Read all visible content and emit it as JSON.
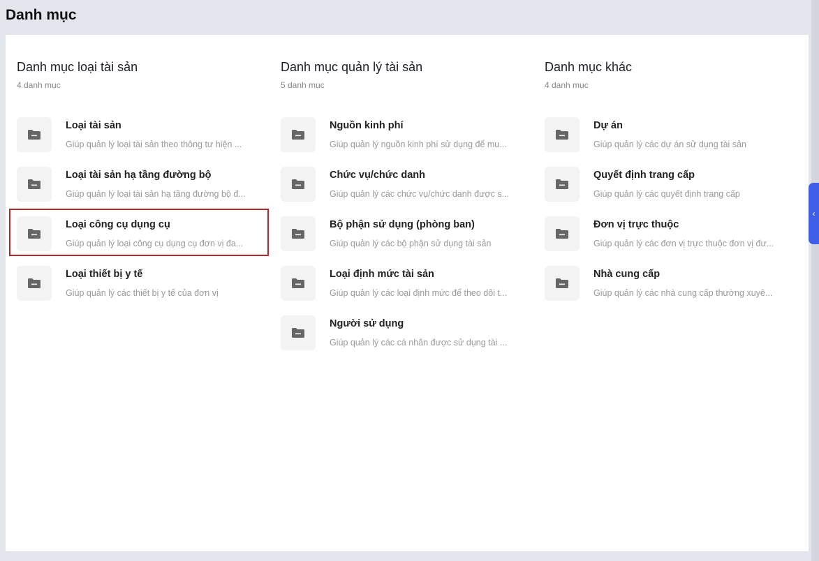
{
  "page_title": "Danh mục",
  "columns": [
    {
      "title": "Danh mục loại tài sản",
      "count": "4 danh mục",
      "items": [
        {
          "title": "Loại tài sản",
          "desc": "Giúp quản lý loại tài sản theo thông tư hiện ..."
        },
        {
          "title": "Loại tài sản hạ tầng đường bộ",
          "desc": "Giúp quản lý loại tài sản hạ tầng đường bộ đ..."
        },
        {
          "title": "Loại công cụ dụng cụ",
          "desc": "Giúp quản lý loại công cụ dụng cụ đơn vị đa..."
        },
        {
          "title": "Loại thiết bị y tế",
          "desc": "Giúp quản lý các thiết bị y tế của đơn vị"
        }
      ]
    },
    {
      "title": "Danh mục quản lý tài sản",
      "count": "5 danh mục",
      "items": [
        {
          "title": "Nguồn kinh phí",
          "desc": "Giúp quản lý nguồn kinh phí sử dụng để mu..."
        },
        {
          "title": "Chức vụ/chức danh",
          "desc": "Giúp quản lý các chức vụ/chức danh được s..."
        },
        {
          "title": "Bộ phận sử dụng (phòng ban)",
          "desc": "Giúp quản lý các bộ phận sử dụng tài sản"
        },
        {
          "title": "Loại định mức tài sản",
          "desc": "Giúp quản lý các loại định mức để theo dõi t..."
        },
        {
          "title": "Người sử dụng",
          "desc": "Giúp quản lý các cá nhân được sử dụng tài ..."
        }
      ]
    },
    {
      "title": "Danh mục khác",
      "count": "4 danh mục",
      "items": [
        {
          "title": "Dự án",
          "desc": "Giúp quản lý các dự án sử dụng tài sản"
        },
        {
          "title": "Quyết định trang cấp",
          "desc": "Giúp quản lý các quyết định trang cấp"
        },
        {
          "title": "Đơn vị trực thuộc",
          "desc": "Giúp quản lý các đơn vị trực thuộc đơn vị đư..."
        },
        {
          "title": "Nhà cung cấp",
          "desc": "Giúp quản lý các nhà cung cấp thường xuyê..."
        }
      ]
    }
  ],
  "collapse_tab": "‹"
}
